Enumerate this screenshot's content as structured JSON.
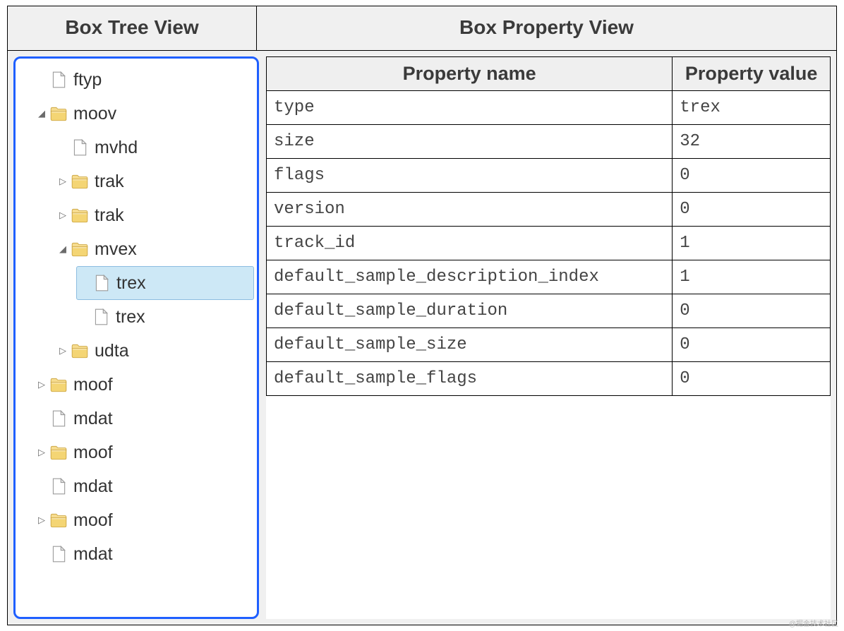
{
  "headers": {
    "tree": "Box Tree View",
    "prop": "Box Property View"
  },
  "prop_columns": [
    "Property name",
    "Property value"
  ],
  "tree": [
    {
      "label": "ftyp",
      "depth": 0,
      "expander": "",
      "icon": "file"
    },
    {
      "label": "moov",
      "depth": 0,
      "expander": "open",
      "icon": "folder"
    },
    {
      "label": "mvhd",
      "depth": 1,
      "expander": "",
      "icon": "file"
    },
    {
      "label": "trak",
      "depth": 1,
      "expander": "closed",
      "icon": "folder"
    },
    {
      "label": "trak",
      "depth": 1,
      "expander": "closed",
      "icon": "folder"
    },
    {
      "label": "mvex",
      "depth": 1,
      "expander": "open",
      "icon": "folder"
    },
    {
      "label": "trex",
      "depth": 2,
      "expander": "",
      "icon": "file",
      "selected": true
    },
    {
      "label": "trex",
      "depth": 2,
      "expander": "",
      "icon": "file"
    },
    {
      "label": "udta",
      "depth": 1,
      "expander": "closed",
      "icon": "folder"
    },
    {
      "label": "moof",
      "depth": 0,
      "expander": "closed",
      "icon": "folder"
    },
    {
      "label": "mdat",
      "depth": 0,
      "expander": "",
      "icon": "file"
    },
    {
      "label": "moof",
      "depth": 0,
      "expander": "closed",
      "icon": "folder"
    },
    {
      "label": "mdat",
      "depth": 0,
      "expander": "",
      "icon": "file"
    },
    {
      "label": "moof",
      "depth": 0,
      "expander": "closed",
      "icon": "folder"
    },
    {
      "label": "mdat",
      "depth": 0,
      "expander": "",
      "icon": "file"
    }
  ],
  "properties": [
    {
      "name": "type",
      "value": "trex"
    },
    {
      "name": "size",
      "value": "32"
    },
    {
      "name": "flags",
      "value": "0"
    },
    {
      "name": "version",
      "value": "0"
    },
    {
      "name": "track_id",
      "value": "1"
    },
    {
      "name": "default_sample_description_index",
      "value": "1"
    },
    {
      "name": "default_sample_duration",
      "value": "0"
    },
    {
      "name": "default_sample_size",
      "value": "0"
    },
    {
      "name": "default_sample_flags",
      "value": "0"
    }
  ],
  "watermark": "@掘金技术社区"
}
